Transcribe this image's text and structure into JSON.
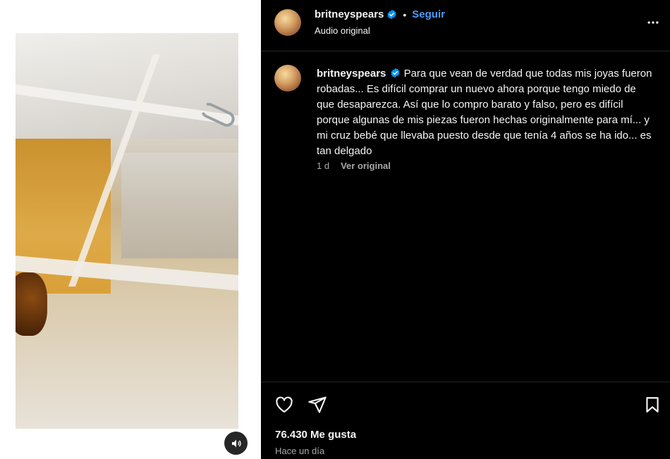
{
  "post": {
    "username": "britneyspears",
    "follow_label": "Seguir",
    "separator": "•",
    "audio": "Audio original",
    "caption": "Para que vean de verdad que todas mis joyas fueron robadas... Es difícil comprar un nuevo ahora porque tengo miedo de que desaparezca. Así que lo compro barato y falso, pero es difícil porque algunas de mis piezas fueron hechas originalmente para mí... y mi cruz bebé que llevaba puesto desde que tenía 4 años se ha ido... es tan delgado",
    "age": "1 d",
    "see_original": "Ver original",
    "likes": "76.430 Me gusta",
    "time": "Hace un día"
  },
  "icons": {
    "verified": "verified-badge-icon",
    "more": "more-options-icon",
    "like": "heart-icon",
    "share": "send-icon",
    "save": "bookmark-icon",
    "audio": "speaker-icon"
  },
  "colors": {
    "background": "#000000",
    "text": "#f5f5f5",
    "muted": "#a8a8a8",
    "link": "#4a9df8",
    "verified": "#0095f6",
    "divider": "#262626"
  }
}
